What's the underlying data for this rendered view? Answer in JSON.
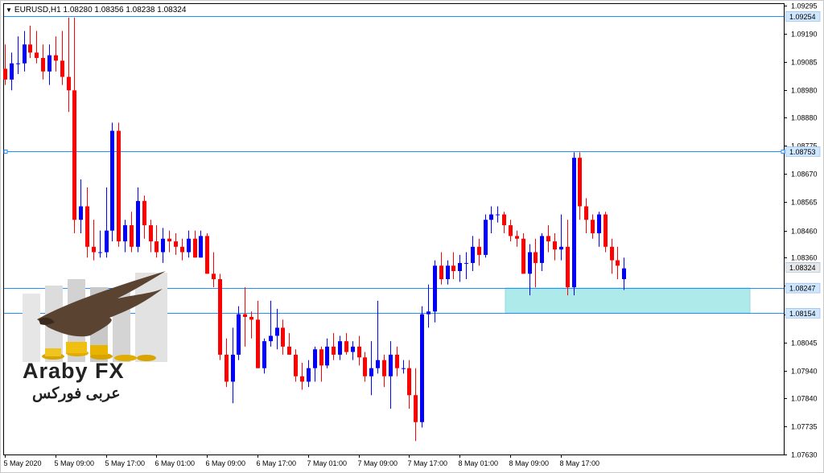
{
  "header": {
    "dropdown_icon": "triangle-down-icon",
    "symbol_info": "EURUSD,H1  1.08280 1.08356 1.08238 1.08324"
  },
  "logo": {
    "text_en": "Araby FX",
    "text_ar": "عربى فوركس",
    "emblem": "eagle-over-gold-coins-icon"
  },
  "colors": {
    "bull": "#0000ff",
    "bear": "#ff0000",
    "level_line": "#1e90ff",
    "zone_fill": "#aeeaea",
    "price_tag": "#cfe6ff"
  },
  "chart_data": {
    "type": "candlestick",
    "symbol": "EURUSD",
    "timeframe": "H1",
    "ylim": [
      1.0763,
      1.093
    ],
    "y_ticks": [
      "1.09295",
      "1.09190",
      "1.09085",
      "1.08980",
      "1.08880",
      "1.08775",
      "1.08670",
      "1.08565",
      "1.08460",
      "1.08360",
      "1.08255",
      "1.08150",
      "1.08045",
      "1.07940",
      "1.07840",
      "1.07735",
      "1.07630"
    ],
    "x_labels": [
      "5 May 2020",
      "5 May 09:00",
      "5 May 17:00",
      "6 May 01:00",
      "6 May 09:00",
      "6 May 17:00",
      "7 May 01:00",
      "7 May 09:00",
      "7 May 17:00",
      "8 May 01:00",
      "8 May 09:00",
      "8 May 17:00"
    ],
    "levels": [
      {
        "price": 1.09254,
        "label": "1.09254"
      },
      {
        "price": 1.08753,
        "label": "1.08753"
      },
      {
        "price": 1.08247,
        "label": "1.08247"
      },
      {
        "price": 1.08154,
        "label": "1.08154"
      }
    ],
    "current_price": {
      "price": 1.08324,
      "label": "1.08324"
    },
    "zone": {
      "top": 1.08247,
      "bottom": 1.08154,
      "from_bar": 78,
      "to_bar": 116
    },
    "ohlc": [
      [
        1.0906,
        1.0915,
        1.09,
        1.0902
      ],
      [
        1.0902,
        1.0912,
        1.0898,
        1.0908
      ],
      [
        1.0908,
        1.0918,
        1.0904,
        1.0908
      ],
      [
        1.0908,
        1.092,
        1.0905,
        1.0915
      ],
      [
        1.0915,
        1.0922,
        1.091,
        1.0912
      ],
      [
        1.0912,
        1.092,
        1.0908,
        1.091
      ],
      [
        1.091,
        1.0915,
        1.0902,
        1.0905
      ],
      [
        1.0905,
        1.0915,
        1.09,
        1.0911
      ],
      [
        1.0911,
        1.0918,
        1.0905,
        1.0909
      ],
      [
        1.0909,
        1.092,
        1.09,
        1.0903
      ],
      [
        1.0903,
        1.0925,
        1.089,
        1.0898
      ],
      [
        1.0898,
        1.0925,
        1.0845,
        1.085
      ],
      [
        1.085,
        1.0865,
        1.0845,
        1.0855
      ],
      [
        1.0855,
        1.0862,
        1.0836,
        1.084
      ],
      [
        1.084,
        1.085,
        1.0835,
        1.0838
      ],
      [
        1.0838,
        1.0846,
        1.0836,
        1.0838
      ],
      [
        1.0838,
        1.0862,
        1.0836,
        1.0846
      ],
      [
        1.0846,
        1.0886,
        1.0842,
        1.0883
      ],
      [
        1.0883,
        1.0886,
        1.084,
        1.0842
      ],
      [
        1.0842,
        1.085,
        1.0838,
        1.0848
      ],
      [
        1.0848,
        1.0853,
        1.0838,
        1.084
      ],
      [
        1.084,
        1.0862,
        1.0838,
        1.0857
      ],
      [
        1.0857,
        1.0859,
        1.0843,
        1.0848
      ],
      [
        1.0848,
        1.085,
        1.0838,
        1.0842
      ],
      [
        1.0842,
        1.0848,
        1.0836,
        1.0838
      ],
      [
        1.0838,
        1.0847,
        1.0834,
        1.0843
      ],
      [
        1.0843,
        1.0846,
        1.0838,
        1.0842
      ],
      [
        1.0842,
        1.0845,
        1.0837,
        1.084
      ],
      [
        1.084,
        1.0843,
        1.0835,
        1.0838
      ],
      [
        1.0838,
        1.0846,
        1.0836,
        1.0843
      ],
      [
        1.0843,
        1.0846,
        1.0836,
        1.0836
      ],
      [
        1.0836,
        1.0846,
        1.0836,
        1.0844
      ],
      [
        1.0844,
        1.0845,
        1.083,
        1.083
      ],
      [
        1.083,
        1.0838,
        1.0825,
        1.0828
      ],
      [
        1.0828,
        1.083,
        1.0798,
        1.08
      ],
      [
        1.08,
        1.0806,
        1.0788,
        1.079
      ],
      [
        1.079,
        1.081,
        1.0782,
        1.08
      ],
      [
        1.08,
        1.0818,
        1.0798,
        1.0815
      ],
      [
        1.0815,
        1.0825,
        1.0803,
        1.0814
      ],
      [
        1.0814,
        1.0816,
        1.0806,
        1.0813
      ],
      [
        1.0813,
        1.082,
        1.0795,
        1.0795
      ],
      [
        1.0795,
        1.0806,
        1.0793,
        1.0805
      ],
      [
        1.0805,
        1.082,
        1.0803,
        1.0807
      ],
      [
        1.0807,
        1.0817,
        1.0802,
        1.081
      ],
      [
        1.081,
        1.0813,
        1.08,
        1.0803
      ],
      [
        1.0803,
        1.0808,
        1.08,
        1.08
      ],
      [
        1.08,
        1.0802,
        1.079,
        1.0792
      ],
      [
        1.0792,
        1.0797,
        1.0787,
        1.079
      ],
      [
        1.079,
        1.0798,
        1.0788,
        1.0795
      ],
      [
        1.0795,
        1.0803,
        1.079,
        1.0802
      ],
      [
        1.0802,
        1.0803,
        1.079,
        1.0796
      ],
      [
        1.0796,
        1.0806,
        1.0795,
        1.0803
      ],
      [
        1.0803,
        1.0808,
        1.0798,
        1.08
      ],
      [
        1.08,
        1.0807,
        1.0798,
        1.0805
      ],
      [
        1.0805,
        1.0808,
        1.08,
        1.0801
      ],
      [
        1.0801,
        1.0805,
        1.0798,
        1.0803
      ],
      [
        1.0803,
        1.0807,
        1.0796,
        1.0799
      ],
      [
        1.0799,
        1.0801,
        1.079,
        1.0792
      ],
      [
        1.0792,
        1.0805,
        1.0785,
        1.0795
      ],
      [
        1.0795,
        1.082,
        1.0793,
        1.0798
      ],
      [
        1.0798,
        1.08,
        1.0788,
        1.0792
      ],
      [
        1.0792,
        1.0805,
        1.078,
        1.08
      ],
      [
        1.08,
        1.0803,
        1.0792,
        1.0795
      ],
      [
        1.0795,
        1.0798,
        1.0793,
        1.0795
      ],
      [
        1.0795,
        1.0798,
        1.078,
        1.0785
      ],
      [
        1.0785,
        1.0795,
        1.0768,
        1.0775
      ],
      [
        1.0775,
        1.0818,
        1.0773,
        1.0815
      ],
      [
        1.0815,
        1.0826,
        1.081,
        1.0816
      ],
      [
        1.0816,
        1.0835,
        1.0812,
        1.0833
      ],
      [
        1.0833,
        1.0838,
        1.0826,
        1.0828
      ],
      [
        1.0828,
        1.0835,
        1.0826,
        1.0833
      ],
      [
        1.0833,
        1.0838,
        1.0828,
        1.0831
      ],
      [
        1.0831,
        1.0837,
        1.0827,
        1.0834
      ],
      [
        1.0834,
        1.0838,
        1.0828,
        1.0834
      ],
      [
        1.0834,
        1.0844,
        1.0831,
        1.084
      ],
      [
        1.084,
        1.0843,
        1.0833,
        1.0837
      ],
      [
        1.0837,
        1.0852,
        1.0836,
        1.085
      ],
      [
        1.085,
        1.0855,
        1.0845,
        1.0852
      ],
      [
        1.0852,
        1.0855,
        1.0849,
        1.0852
      ],
      [
        1.0852,
        1.0853,
        1.0845,
        1.0848
      ],
      [
        1.0848,
        1.085,
        1.0842,
        1.0844
      ],
      [
        1.0844,
        1.0846,
        1.084,
        1.0843
      ],
      [
        1.0843,
        1.0845,
        1.083,
        1.083
      ],
      [
        1.083,
        1.0841,
        1.0822,
        1.0838
      ],
      [
        1.0838,
        1.0843,
        1.0825,
        1.0834
      ],
      [
        1.0834,
        1.0845,
        1.0831,
        1.0844
      ],
      [
        1.0844,
        1.0848,
        1.0838,
        1.0842
      ],
      [
        1.0842,
        1.0845,
        1.0835,
        1.0839
      ],
      [
        1.0839,
        1.0852,
        1.0835,
        1.084
      ],
      [
        1.084,
        1.085,
        1.0822,
        1.0825
      ],
      [
        1.0825,
        1.0875,
        1.0822,
        1.0873
      ],
      [
        1.0873,
        1.0875,
        1.085,
        1.0855
      ],
      [
        1.0855,
        1.0858,
        1.0845,
        1.085
      ],
      [
        1.085,
        1.0852,
        1.0843,
        1.0845
      ],
      [
        1.0845,
        1.0853,
        1.084,
        1.0852
      ],
      [
        1.0852,
        1.0853,
        1.0838,
        1.084
      ],
      [
        1.084,
        1.0843,
        1.083,
        1.0835
      ],
      [
        1.0835,
        1.084,
        1.0828,
        1.0833
      ],
      [
        1.0828,
        1.0836,
        1.0824,
        1.0832
      ]
    ]
  }
}
